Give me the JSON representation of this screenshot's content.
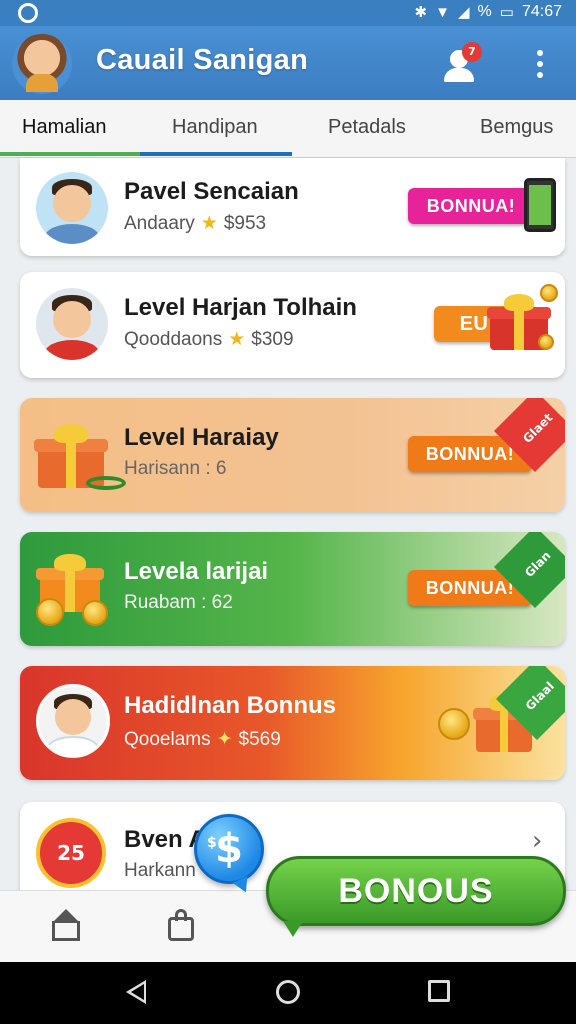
{
  "status_bar": {
    "time": "74:67",
    "battery_label": "%"
  },
  "app": {
    "title": "Cauail Sanigan",
    "notification_count": "7"
  },
  "tabs": [
    {
      "label": "Hamalian",
      "active": true
    },
    {
      "label": "Handipan",
      "active": false
    },
    {
      "label": "Petadals",
      "active": false
    },
    {
      "label": "Bemgus",
      "active": false
    }
  ],
  "list": [
    {
      "title": "Pavel Sencaian",
      "subtitle": "Andaary",
      "amount": "$953",
      "button": "BONNUA!",
      "button_color": "#e8239a"
    },
    {
      "title": "Level Harjan Tolhain",
      "subtitle": "Qooddaons",
      "amount": "$309",
      "button": "EU",
      "button_color": "#f28a1e"
    },
    {
      "title": "Level Haraiay",
      "subtitle": "Harisann : 6",
      "button": "BONNUA!",
      "tag": "Glaet",
      "button_color": "#f07a18"
    },
    {
      "title": "Levela larijai",
      "subtitle": "Ruabam : 62",
      "button": "BONNUA!",
      "tag": "Glan",
      "button_color": "#f07a18"
    },
    {
      "title": "Hadidlnan Bonnus",
      "subtitle": "Qooelams",
      "amount": "$569",
      "tag": "Glaal"
    },
    {
      "title": "Bven A",
      "subtitle": "Harkann"
    }
  ],
  "cta": {
    "label": "BONOUS",
    "bubble_symbol": "$",
    "bubble_small": "$"
  },
  "colors": {
    "primary": "#3b7dc0",
    "cta_green": "#4cae33",
    "tab_green": "#4caf50",
    "tab_blue": "#1e6fc0"
  }
}
